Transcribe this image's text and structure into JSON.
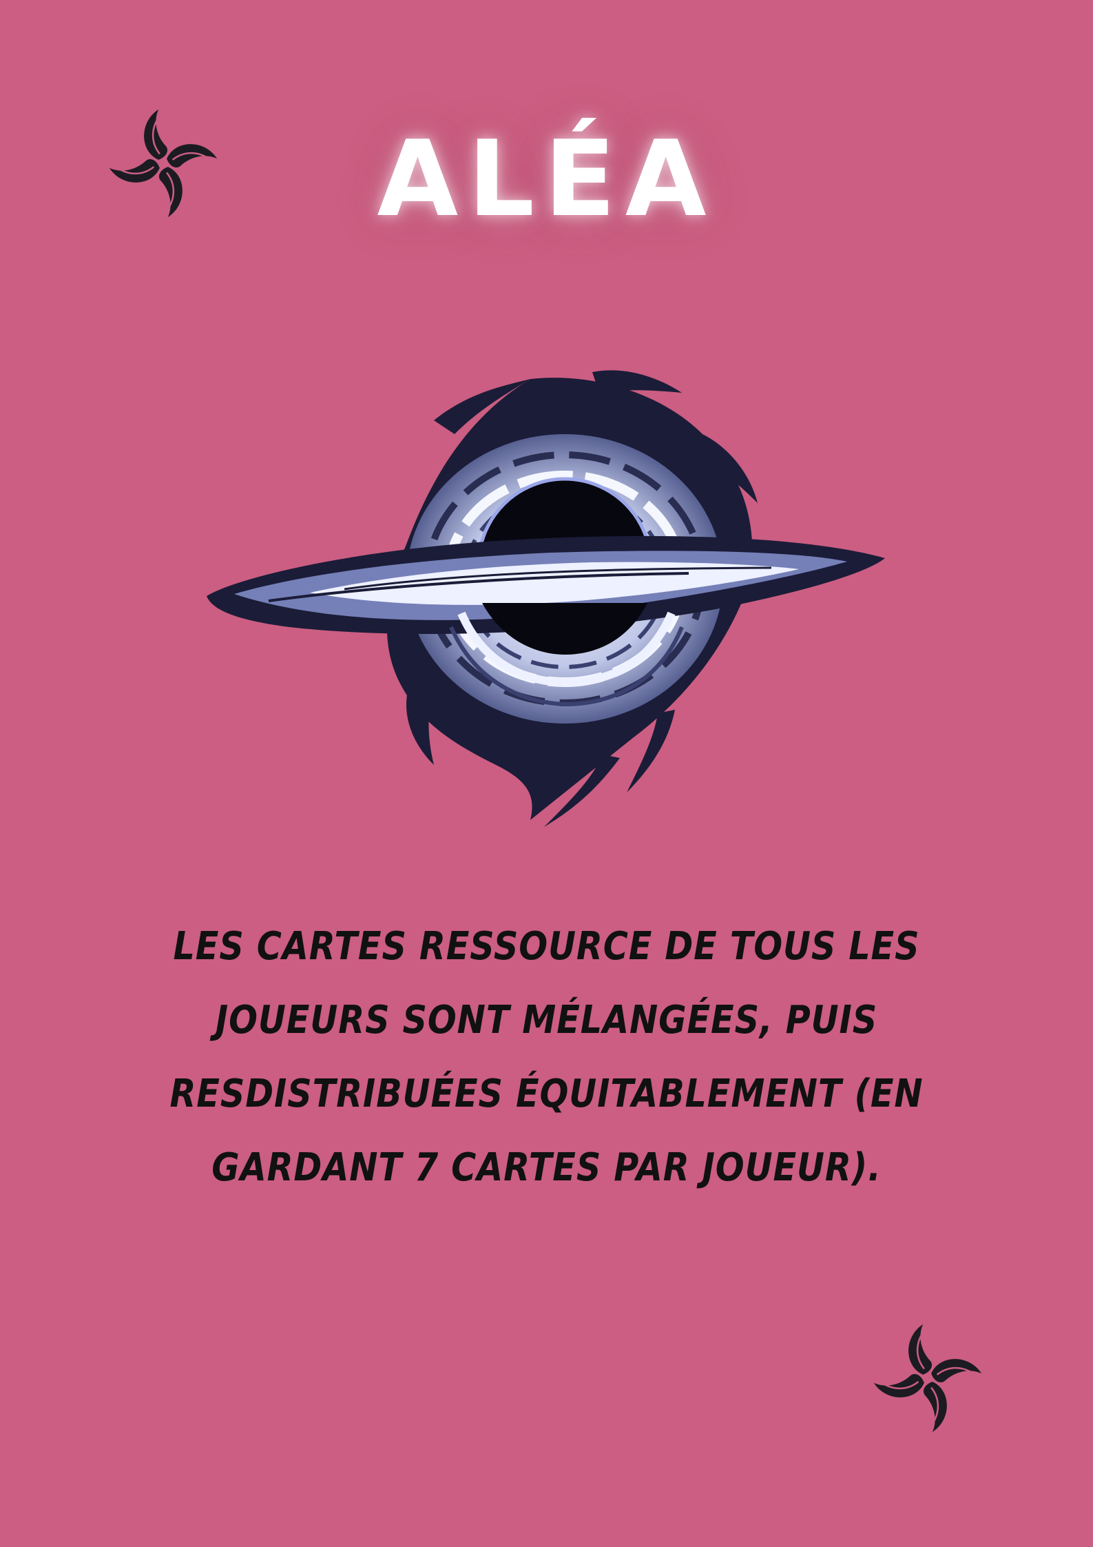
{
  "card": {
    "title": "ALÉA",
    "effect_text": "LES CARTES RESSOURCE DE TOUS LES JOUEURS SONT MÉLANGÉES, PUIS RESDISTRIBUÉES ÉQUITABLEMENT (EN GARDANT 7 CARTES PAR JOUEUR).",
    "illustration": "black-hole-icon",
    "corner_symbol": "swirl-emblem-icon"
  },
  "colors": {
    "background": "#cb5e82",
    "title": "#ffffff",
    "text": "#111111",
    "emblem": "#1c1b22",
    "disk_dark": "#1b1c38",
    "disk_mid": "#5a6496",
    "disk_light": "#e8ecff"
  }
}
